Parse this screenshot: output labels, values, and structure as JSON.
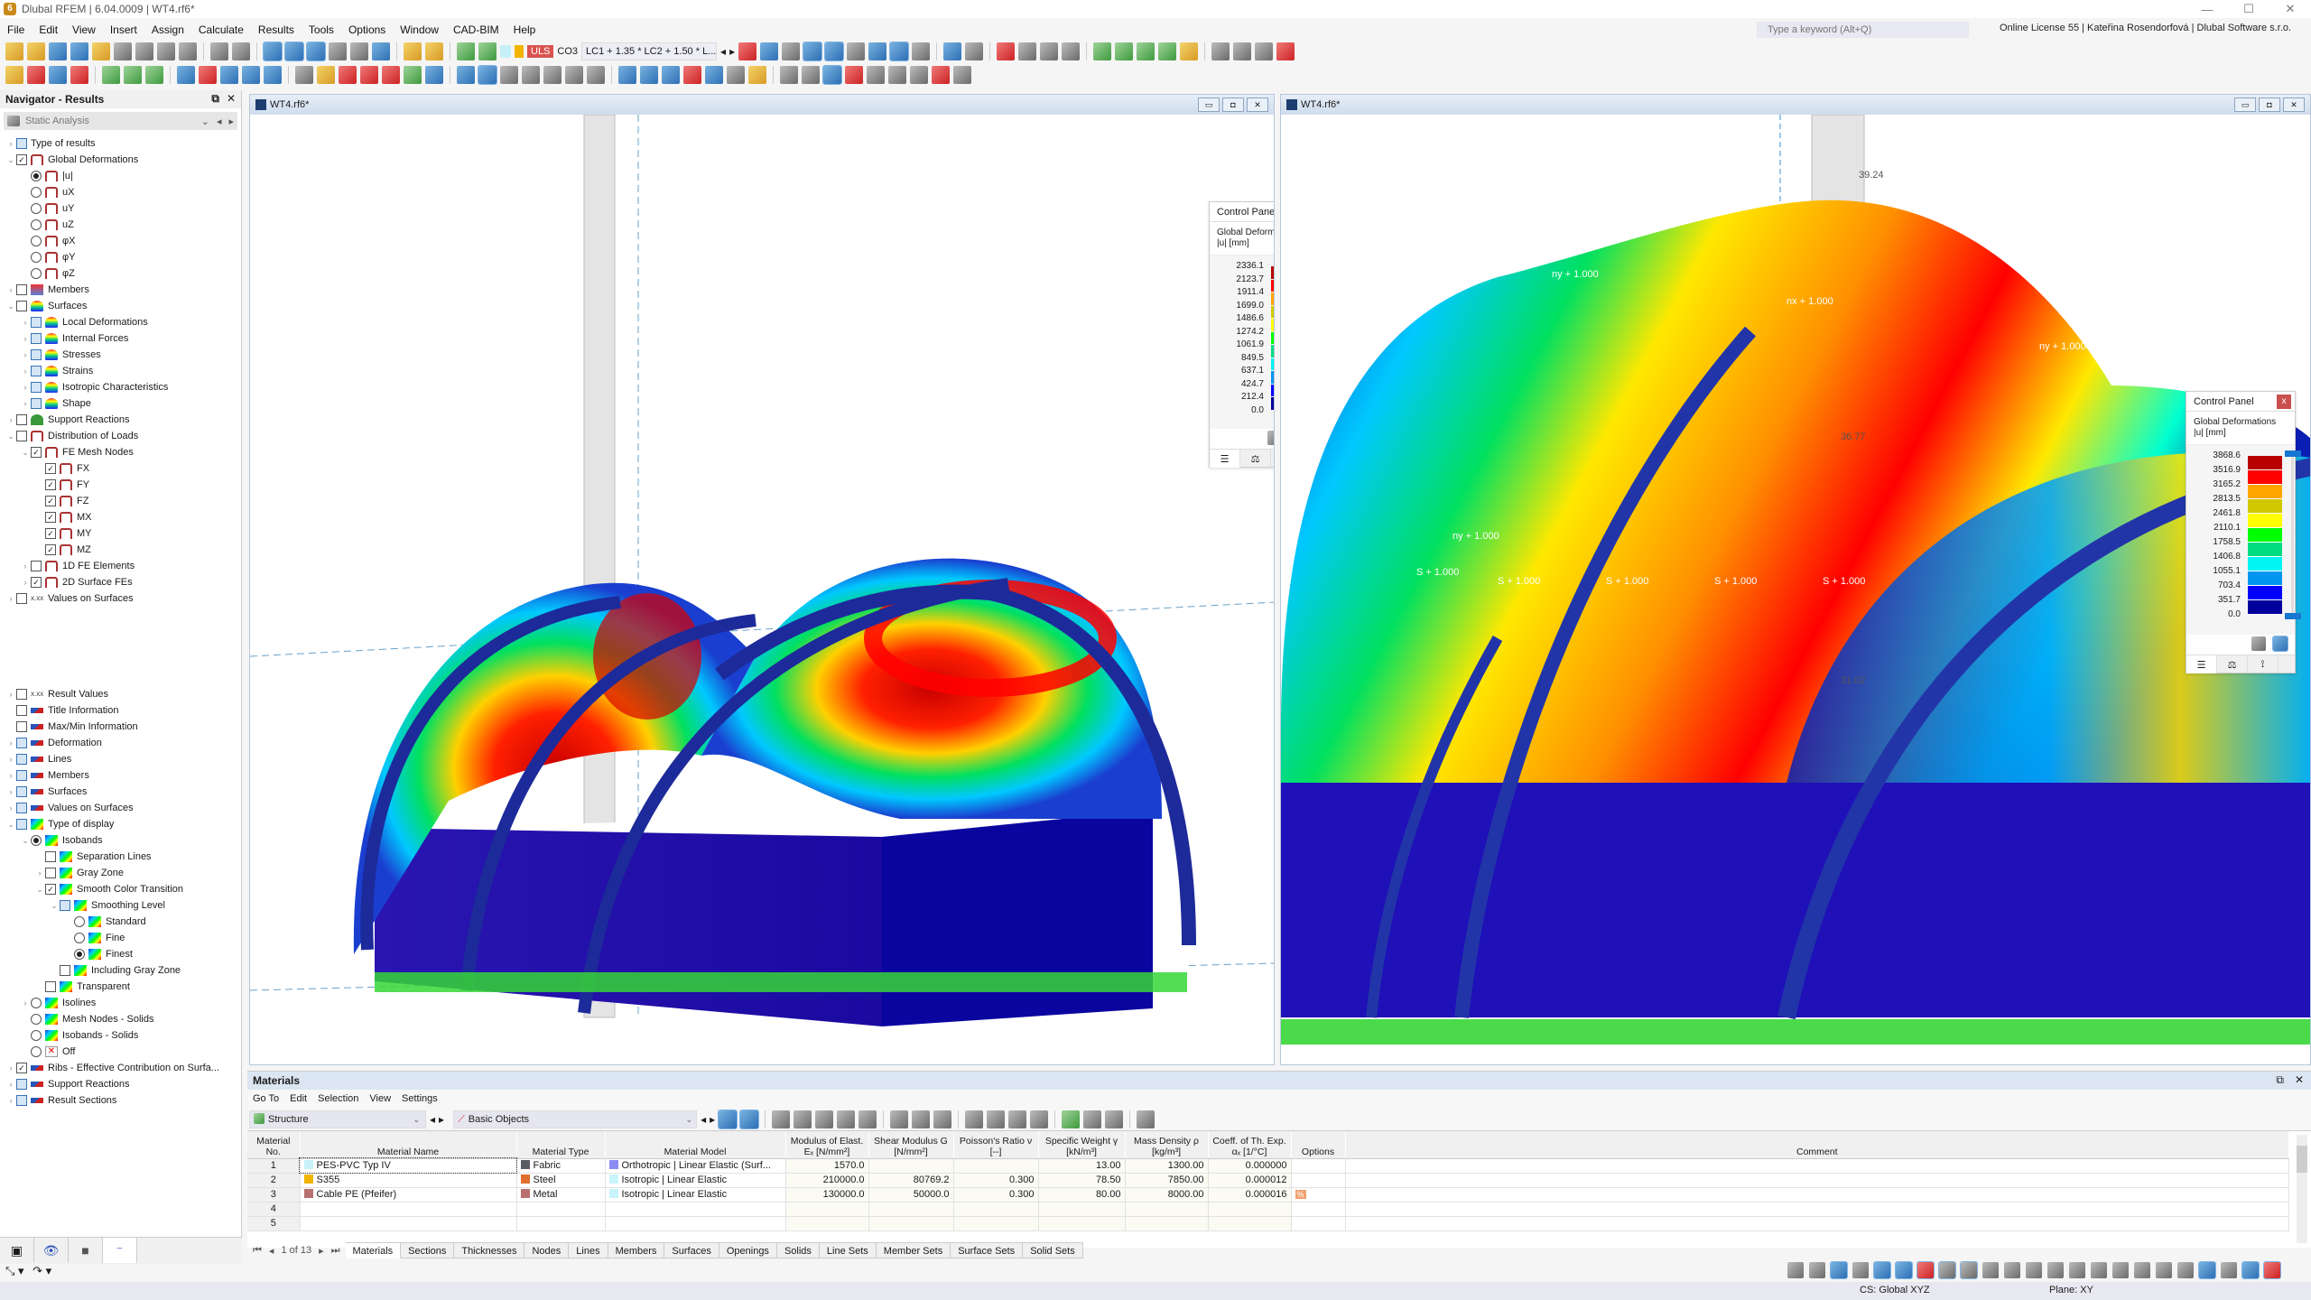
{
  "window": {
    "title": "Dlubal RFEM | 6.04.0009 | WT4.rf6*",
    "controls": {
      "minimize": "—",
      "maximize": "☐",
      "close": "✕"
    }
  },
  "menu": [
    "File",
    "Edit",
    "View",
    "Insert",
    "Assign",
    "Calculate",
    "Results",
    "Tools",
    "Options",
    "Window",
    "CAD-BIM",
    "Help"
  ],
  "search": {
    "placeholder": "Type a keyword (Alt+Q)"
  },
  "license": "Online License 55 | Kateřina Rosendorfová | Dlubal Software s.r.o.",
  "toolbar": {
    "design_situation": "ULS",
    "combination": "CO3",
    "combination_formula": "LC1 + 1.35 * LC2 + 1.50 * L..."
  },
  "navigator": {
    "title": "Navigator - Results",
    "analysis": "Static Analysis",
    "tree": [
      {
        "label": "Type of results",
        "level": 0,
        "exp": ">",
        "ctl": "cb-part",
        "icon": "none"
      },
      {
        "label": "Global Deformations",
        "level": 0,
        "exp": "v",
        "ctl": "cb-on",
        "icon": "frame"
      },
      {
        "label": "|u|",
        "level": 1,
        "exp": "",
        "ctl": "rb-on",
        "icon": "frame"
      },
      {
        "label": "uX",
        "level": 1,
        "exp": "",
        "ctl": "rb",
        "icon": "frame"
      },
      {
        "label": "uY",
        "level": 1,
        "exp": "",
        "ctl": "rb",
        "icon": "frame"
      },
      {
        "label": "uZ",
        "level": 1,
        "exp": "",
        "ctl": "rb",
        "icon": "frame"
      },
      {
        "label": "φX",
        "level": 1,
        "exp": "",
        "ctl": "rb",
        "icon": "frame"
      },
      {
        "label": "φY",
        "level": 1,
        "exp": "",
        "ctl": "rb",
        "icon": "frame"
      },
      {
        "label": "φZ",
        "level": 1,
        "exp": "",
        "ctl": "rb",
        "icon": "frame"
      },
      {
        "label": "Members",
        "level": 0,
        "exp": ">",
        "ctl": "cb",
        "icon": "mem"
      },
      {
        "label": "Surfaces",
        "level": 0,
        "exp": "v",
        "ctl": "cb",
        "icon": "surf"
      },
      {
        "label": "Local Deformations",
        "level": 1,
        "exp": ">",
        "ctl": "cb-part",
        "icon": "surf"
      },
      {
        "label": "Internal Forces",
        "level": 1,
        "exp": ">",
        "ctl": "cb-part",
        "icon": "surf"
      },
      {
        "label": "Stresses",
        "level": 1,
        "exp": ">",
        "ctl": "cb-part",
        "icon": "surf"
      },
      {
        "label": "Strains",
        "level": 1,
        "exp": ">",
        "ctl": "cb-part",
        "icon": "surf"
      },
      {
        "label": "Isotropic Characteristics",
        "level": 1,
        "exp": ">",
        "ctl": "cb-part",
        "icon": "surf"
      },
      {
        "label": "Shape",
        "level": 1,
        "exp": ">",
        "ctl": "cb-part",
        "icon": "surf"
      },
      {
        "label": "Support Reactions",
        "level": 0,
        "exp": ">",
        "ctl": "cb",
        "icon": "sup"
      },
      {
        "label": "Distribution of Loads",
        "level": 0,
        "exp": "v",
        "ctl": "cb",
        "icon": "frame"
      },
      {
        "label": "FE Mesh Nodes",
        "level": 1,
        "exp": "v",
        "ctl": "cb-on",
        "icon": "frame"
      },
      {
        "label": "FX",
        "level": 2,
        "exp": "",
        "ctl": "cb-on",
        "icon": "frame"
      },
      {
        "label": "FY",
        "level": 2,
        "exp": "",
        "ctl": "cb-on",
        "icon": "frame"
      },
      {
        "label": "FZ",
        "level": 2,
        "exp": "",
        "ctl": "cb-on",
        "icon": "frame"
      },
      {
        "label": "MX",
        "level": 2,
        "exp": "",
        "ctl": "cb-on",
        "icon": "frame"
      },
      {
        "label": "MY",
        "level": 2,
        "exp": "",
        "ctl": "cb-on",
        "icon": "frame"
      },
      {
        "label": "MZ",
        "level": 2,
        "exp": "",
        "ctl": "cb-on",
        "icon": "frame"
      },
      {
        "label": "1D FE Elements",
        "level": 1,
        "exp": ">",
        "ctl": "cb",
        "icon": "frame"
      },
      {
        "label": "2D Surface FEs",
        "level": 1,
        "exp": ">",
        "ctl": "cb-on",
        "icon": "frame"
      },
      {
        "label": "Values on Surfaces",
        "level": 0,
        "exp": ">",
        "ctl": "cb",
        "icon": "xx"
      }
    ],
    "tree2": [
      {
        "label": "Result Values",
        "level": 0,
        "exp": ">",
        "ctl": "cb",
        "icon": "xx"
      },
      {
        "label": "Title Information",
        "level": 0,
        "exp": "",
        "ctl": "cb",
        "icon": "eye"
      },
      {
        "label": "Max/Min Information",
        "level": 0,
        "exp": "",
        "ctl": "cb",
        "icon": "eye"
      },
      {
        "label": "Deformation",
        "level": 0,
        "exp": ">",
        "ctl": "cb-part",
        "icon": "eye"
      },
      {
        "label": "Lines",
        "level": 0,
        "exp": ">",
        "ctl": "cb-part",
        "icon": "eye"
      },
      {
        "label": "Members",
        "level": 0,
        "exp": ">",
        "ctl": "cb-part",
        "icon": "eye"
      },
      {
        "label": "Surfaces",
        "level": 0,
        "exp": ">",
        "ctl": "cb-part",
        "icon": "eye"
      },
      {
        "label": "Values on Surfaces",
        "level": 0,
        "exp": ">",
        "ctl": "cb-part",
        "icon": "eye"
      },
      {
        "label": "Type of display",
        "level": 0,
        "exp": "v",
        "ctl": "cb-part",
        "icon": "iso"
      },
      {
        "label": "Isobands",
        "level": 1,
        "exp": "v",
        "ctl": "rb-on",
        "icon": "iso"
      },
      {
        "label": "Separation Lines",
        "level": 2,
        "exp": "",
        "ctl": "cb",
        "icon": "iso"
      },
      {
        "label": "Gray Zone",
        "level": 2,
        "exp": ">",
        "ctl": "cb",
        "icon": "iso"
      },
      {
        "label": "Smooth Color Transition",
        "level": 2,
        "exp": "v",
        "ctl": "cb-on",
        "icon": "iso"
      },
      {
        "label": "Smoothing Level",
        "level": 3,
        "exp": "v",
        "ctl": "cb-part",
        "icon": "iso"
      },
      {
        "label": "Standard",
        "level": 4,
        "exp": "",
        "ctl": "rb",
        "icon": "iso"
      },
      {
        "label": "Fine",
        "level": 4,
        "exp": "",
        "ctl": "rb",
        "icon": "iso"
      },
      {
        "label": "Finest",
        "level": 4,
        "exp": "",
        "ctl": "rb-on",
        "icon": "iso"
      },
      {
        "label": "Including Gray Zone",
        "level": 3,
        "exp": "",
        "ctl": "cb",
        "icon": "iso"
      },
      {
        "label": "Transparent",
        "level": 2,
        "exp": "",
        "ctl": "cb",
        "icon": "iso"
      },
      {
        "label": "Isolines",
        "level": 1,
        "exp": ">",
        "ctl": "rb",
        "icon": "iso"
      },
      {
        "label": "Mesh Nodes - Solids",
        "level": 1,
        "exp": "",
        "ctl": "rb",
        "icon": "iso"
      },
      {
        "label": "Isobands - Solids",
        "level": 1,
        "exp": "",
        "ctl": "rb",
        "icon": "iso"
      },
      {
        "label": "Off",
        "level": 1,
        "exp": "",
        "ctl": "rb",
        "icon": "off"
      },
      {
        "label": "Ribs - Effective Contribution on Surfa...",
        "level": 0,
        "exp": ">",
        "ctl": "cb-on",
        "icon": "eye"
      },
      {
        "label": "Support Reactions",
        "level": 0,
        "exp": ">",
        "ctl": "cb-part",
        "icon": "eye"
      },
      {
        "label": "Result Sections",
        "level": 0,
        "exp": ">",
        "ctl": "cb-part",
        "icon": "eye"
      }
    ]
  },
  "viewports": [
    {
      "title": "WT4.rf6*"
    },
    {
      "title": "WT4.rf6*"
    }
  ],
  "control_panels": [
    {
      "title": "Control Panel",
      "result": "Global Deformations",
      "unit": "|u| [mm]",
      "values": [
        "2336.1",
        "2123.7",
        "1911.4",
        "1699.0",
        "1486.6",
        "1274.2",
        "1061.9",
        "849.5",
        "637.1",
        "424.7",
        "212.4",
        "0.0"
      ]
    },
    {
      "title": "Control Panel",
      "result": "Global Deformations",
      "unit": "|u| [mm]",
      "values": [
        "3868.6",
        "3516.9",
        "3165.2",
        "2813.5",
        "2461.8",
        "2110.1",
        "1758.5",
        "1406.8",
        "1055.1",
        "703.4",
        "351.7",
        "0.0"
      ]
    }
  ],
  "legend_colors": [
    "#b80000",
    "#ff0000",
    "#ffa500",
    "#d2c800",
    "#ffff00",
    "#00ff00",
    "#00dc82",
    "#00f5f5",
    "#0096f0",
    "#0000ff",
    "#00009b"
  ],
  "model_labels": {
    "right": [
      "ny + 1.000",
      "nx + 1.000",
      "ny + 1.000",
      "ny + 1.000",
      "S + 1.000",
      "S + 1.000",
      "S + 1.000",
      "S + 1.000",
      "S + 1.000",
      "39.24",
      "36.77",
      "31.02"
    ]
  },
  "table": {
    "title": "Materials",
    "menu": [
      "Go To",
      "Edit",
      "Selection",
      "View",
      "Settings"
    ],
    "combo1": "Structure",
    "combo2": "Basic Objects",
    "headers": [
      "Material No.",
      "Material Name",
      "Material Type",
      "Material Model",
      "Modulus of Elast. Eₓ [N/mm²]",
      "Shear Modulus G [N/mm²]",
      "Poisson's Ratio ν [--]",
      "Specific Weight γ [kN/m³]",
      "Mass Density ρ [kg/m³]",
      "Coeff. of Th. Exp. αₓ [1/°C]",
      "Options",
      "Comment"
    ],
    "rows": [
      {
        "no": "1",
        "name": "PES-PVC Typ IV",
        "name_color": "#c8f0f8",
        "type": "Fabric",
        "type_color": "#5a5a64",
        "model": "Orthotropic | Linear Elastic (Surf...",
        "model_color": "#8c8cf5",
        "E": "1570.0",
        "G": "",
        "nu": "",
        "gamma": "13.00",
        "rho": "1300.00",
        "alpha": "0.000000",
        "options": ""
      },
      {
        "no": "2",
        "name": "S355",
        "name_color": "#f3b400",
        "type": "Steel",
        "type_color": "#e0702d",
        "model": "Isotropic | Linear Elastic",
        "model_color": "#c8f5fa",
        "E": "210000.0",
        "G": "80769.2",
        "nu": "0.300",
        "gamma": "78.50",
        "rho": "7850.00",
        "alpha": "0.000012",
        "options": ""
      },
      {
        "no": "3",
        "name": "Cable PE (Pfeifer)",
        "name_color": "#b87070",
        "type": "Metal",
        "type_color": "#b87070",
        "model": "Isotropic | Linear Elastic",
        "model_color": "#c8f5fa",
        "E": "130000.0",
        "G": "50000.0",
        "nu": "0.300",
        "gamma": "80.00",
        "rho": "8000.00",
        "alpha": "0.000016",
        "options": "%"
      },
      {
        "no": "4",
        "name": "",
        "name_color": "",
        "type": "",
        "type_color": "",
        "model": "",
        "model_color": "",
        "E": "",
        "G": "",
        "nu": "",
        "gamma": "",
        "rho": "",
        "alpha": "",
        "options": ""
      },
      {
        "no": "5",
        "name": "",
        "name_color": "",
        "type": "",
        "type_color": "",
        "model": "",
        "model_color": "",
        "E": "",
        "G": "",
        "nu": "",
        "gamma": "",
        "rho": "",
        "alpha": "",
        "options": ""
      }
    ],
    "pager": "1 of 13",
    "tabs": [
      "Materials",
      "Sections",
      "Thicknesses",
      "Nodes",
      "Lines",
      "Members",
      "Surfaces",
      "Openings",
      "Solids",
      "Line Sets",
      "Member Sets",
      "Surface Sets",
      "Solid Sets"
    ],
    "active_tab": "Materials"
  },
  "status": {
    "cs": "CS: Global XYZ",
    "plane": "Plane: XY"
  }
}
